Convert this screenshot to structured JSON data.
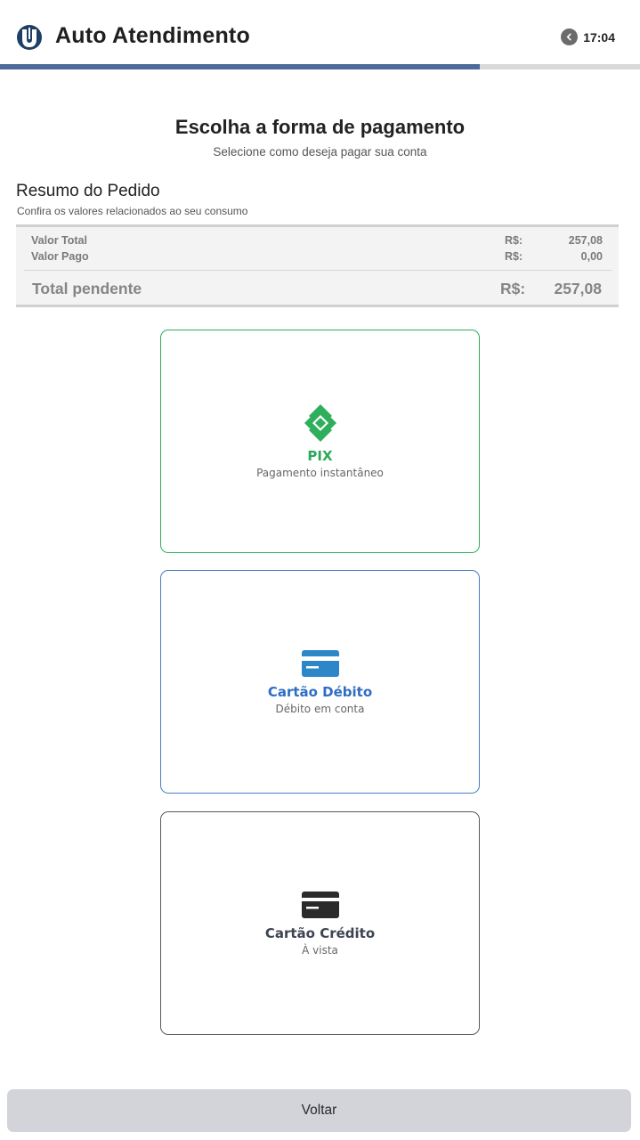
{
  "header": {
    "title": "Auto Atendimento",
    "logo_icon": "university-logo-icon",
    "timer_icon": "chevron-left-icon",
    "time": "17:04",
    "progress_fraction": 0.75,
    "accent_color": "#4d6a9a"
  },
  "main": {
    "title": "Escolha a forma de pagamento",
    "subtitle": "Selecione como deseja pagar sua conta"
  },
  "summary": {
    "title": "Resumo do Pedido",
    "subtitle": "Confira os valores relacionados ao seu consumo",
    "rows": [
      {
        "label": "Valor Total",
        "currency": "R$:",
        "value": "257,08"
      },
      {
        "label": "Valor Pago",
        "currency": "R$:",
        "value": "0,00"
      }
    ],
    "total": {
      "label": "Total pendente",
      "currency": "R$:",
      "value": "257,08"
    }
  },
  "payment_options": [
    {
      "name": "PIX",
      "description": "Pagamento instantâneo",
      "icon": "pix-icon",
      "color": "#2fae5c"
    },
    {
      "name": "Cartão Débito",
      "description": "Débito em conta",
      "icon": "debit-card-icon",
      "color": "#2f6dc4"
    },
    {
      "name": "Cartão Crédito",
      "description": "À vista",
      "icon": "credit-card-icon",
      "color": "#3e4452"
    }
  ],
  "footer": {
    "back_label": "Voltar"
  }
}
